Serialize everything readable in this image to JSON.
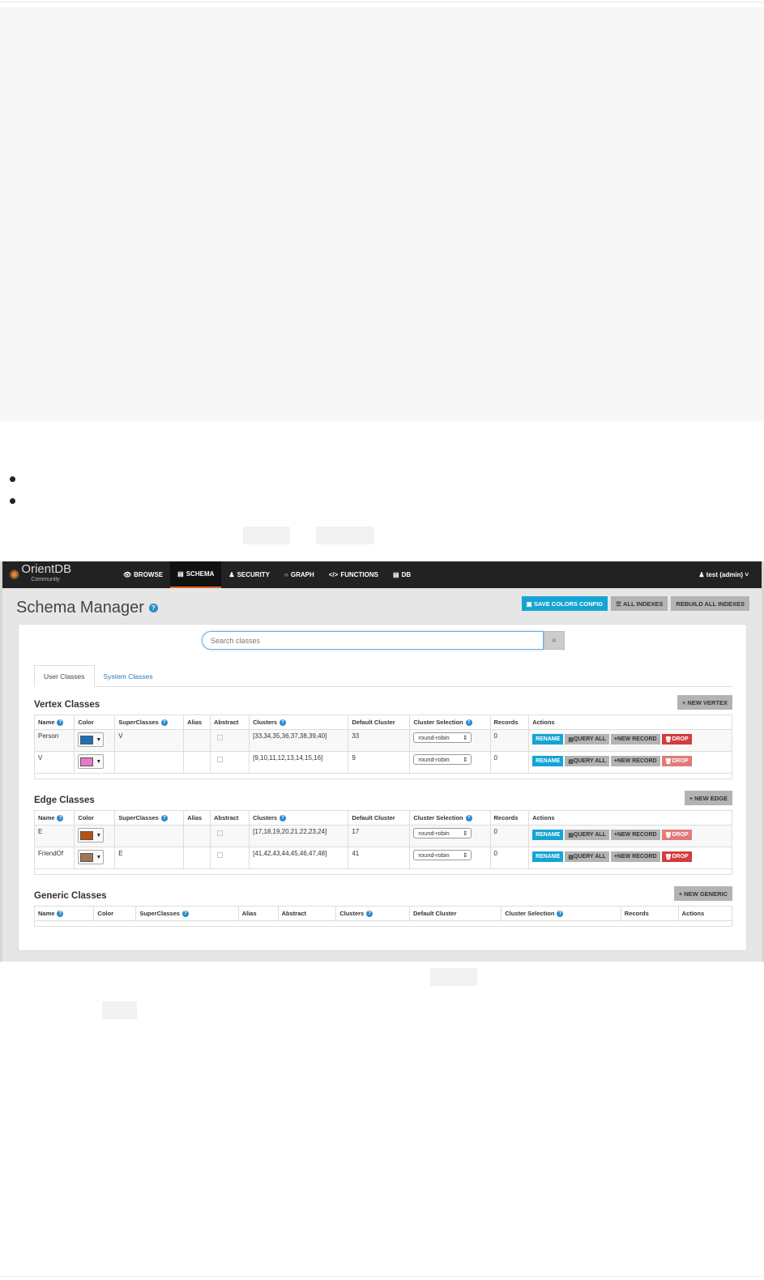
{
  "nav": {
    "brand": "OrientDB",
    "brand_sub": "Community",
    "items": [
      {
        "icon": "eye-icon",
        "glyph": "👁",
        "label": "BROWSE",
        "active": false
      },
      {
        "icon": "table-icon",
        "glyph": "▤",
        "label": "SCHEMA",
        "active": true
      },
      {
        "icon": "user-icon",
        "glyph": "♟",
        "label": "SECURITY",
        "active": false
      },
      {
        "icon": "circle-icon",
        "glyph": "○",
        "label": "GRAPH",
        "active": false
      },
      {
        "icon": "code-icon",
        "glyph": "</>",
        "label": "FUNCTIONS",
        "active": false
      },
      {
        "icon": "database-icon",
        "glyph": "▤",
        "label": "DB",
        "active": false
      }
    ],
    "user": "test (admin)"
  },
  "header": {
    "title": "Schema Manager",
    "save_colors": "SAVE COLORS CONFIG",
    "all_indexes": "ALL INDEXES",
    "rebuild_indexes": "REBUILD ALL INDEXES"
  },
  "search": {
    "placeholder": "Search classes"
  },
  "tabs": [
    "User Classes",
    "System Classes"
  ],
  "vertex": {
    "title": "Vertex Classes",
    "new_button": "NEW VERTEX",
    "headers": [
      "Name",
      "Color",
      "SuperClasses",
      "Alias",
      "Abstract",
      "Clusters",
      "Default Cluster",
      "Cluster Selection",
      "Records",
      "Actions"
    ],
    "rows": [
      {
        "name": "Person",
        "color": "#1f6fb5",
        "superclasses": "V",
        "alias": "",
        "clusters": "[33,34,35,36,37,38,39,40]",
        "default_cluster": "33",
        "selection": "round-robin",
        "records": "0",
        "drop_enabled": true
      },
      {
        "name": "V",
        "color": "#e879c8",
        "superclasses": "",
        "alias": "",
        "clusters": "[9,10,11,12,13,14,15,16]",
        "default_cluster": "9",
        "selection": "round-robin",
        "records": "0",
        "drop_enabled": false
      }
    ]
  },
  "edge": {
    "title": "Edge Classes",
    "new_button": "NEW EDGE",
    "headers": [
      "Name",
      "Color",
      "SuperClasses",
      "Alias",
      "Abstract",
      "Clusters",
      "Default Cluster",
      "Cluster Selection",
      "Records",
      "Actions"
    ],
    "rows": [
      {
        "name": "E",
        "color": "#b5530f",
        "superclasses": "",
        "alias": "",
        "clusters": "[17,18,19,20,21,22,23,24]",
        "default_cluster": "17",
        "selection": "round-robin",
        "records": "0",
        "drop_enabled": false
      },
      {
        "name": "FriendOf",
        "color": "#a07551",
        "superclasses": "E",
        "alias": "",
        "clusters": "[41,42,43,44,45,46,47,48]",
        "default_cluster": "41",
        "selection": "round-robin",
        "records": "0",
        "drop_enabled": true
      }
    ]
  },
  "generic": {
    "title": "Generic Classes",
    "new_button": "NEW GENERIC",
    "headers": [
      "Name",
      "Color",
      "SuperClasses",
      "Alias",
      "Abstract",
      "Clusters",
      "Default Cluster",
      "Cluster Selection",
      "Records",
      "Actions"
    ]
  },
  "actions": {
    "rename": "RENAME",
    "query_all": "QUERY ALL",
    "new_record": "NEW RECORD",
    "drop": "DROP"
  }
}
